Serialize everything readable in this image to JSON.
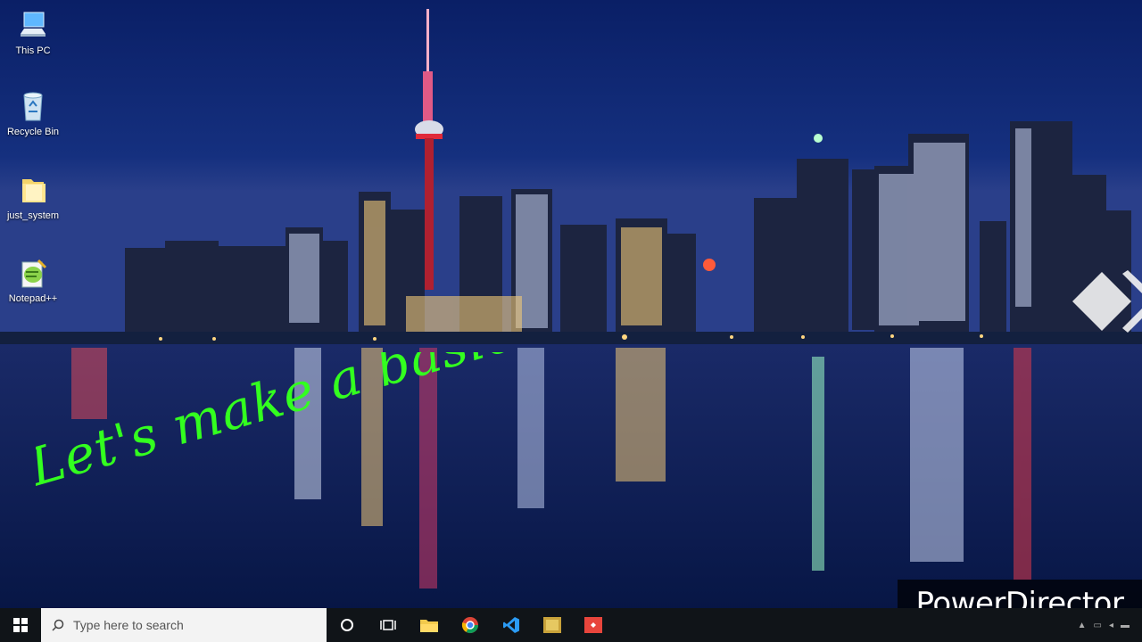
{
  "desktop": {
    "icons": [
      {
        "label": "This PC",
        "icon": "monitor-icon"
      },
      {
        "label": "Recycle Bin",
        "icon": "recycle-bin-icon"
      },
      {
        "label": "just_system",
        "icon": "folder-icon"
      },
      {
        "label": "Notepad++",
        "icon": "notepad-plus-plus-icon"
      }
    ]
  },
  "caption": {
    "text": "Let's make a basic calculator using QB",
    "color": "#33ff1f"
  },
  "watermark": {
    "text": "PowerDirector"
  },
  "taskbar": {
    "start_icon": "windows-logo-icon",
    "search_placeholder": "Type here to search",
    "apps": [
      "cortana-icon",
      "task-view-icon",
      "file-explorer-icon",
      "chrome-icon",
      "vscode-icon",
      "qb64-icon",
      "anydesk-icon"
    ]
  },
  "colors": {
    "sky": "#0a1f66",
    "taskbar": "#101418",
    "accent": "#33ff1f"
  }
}
